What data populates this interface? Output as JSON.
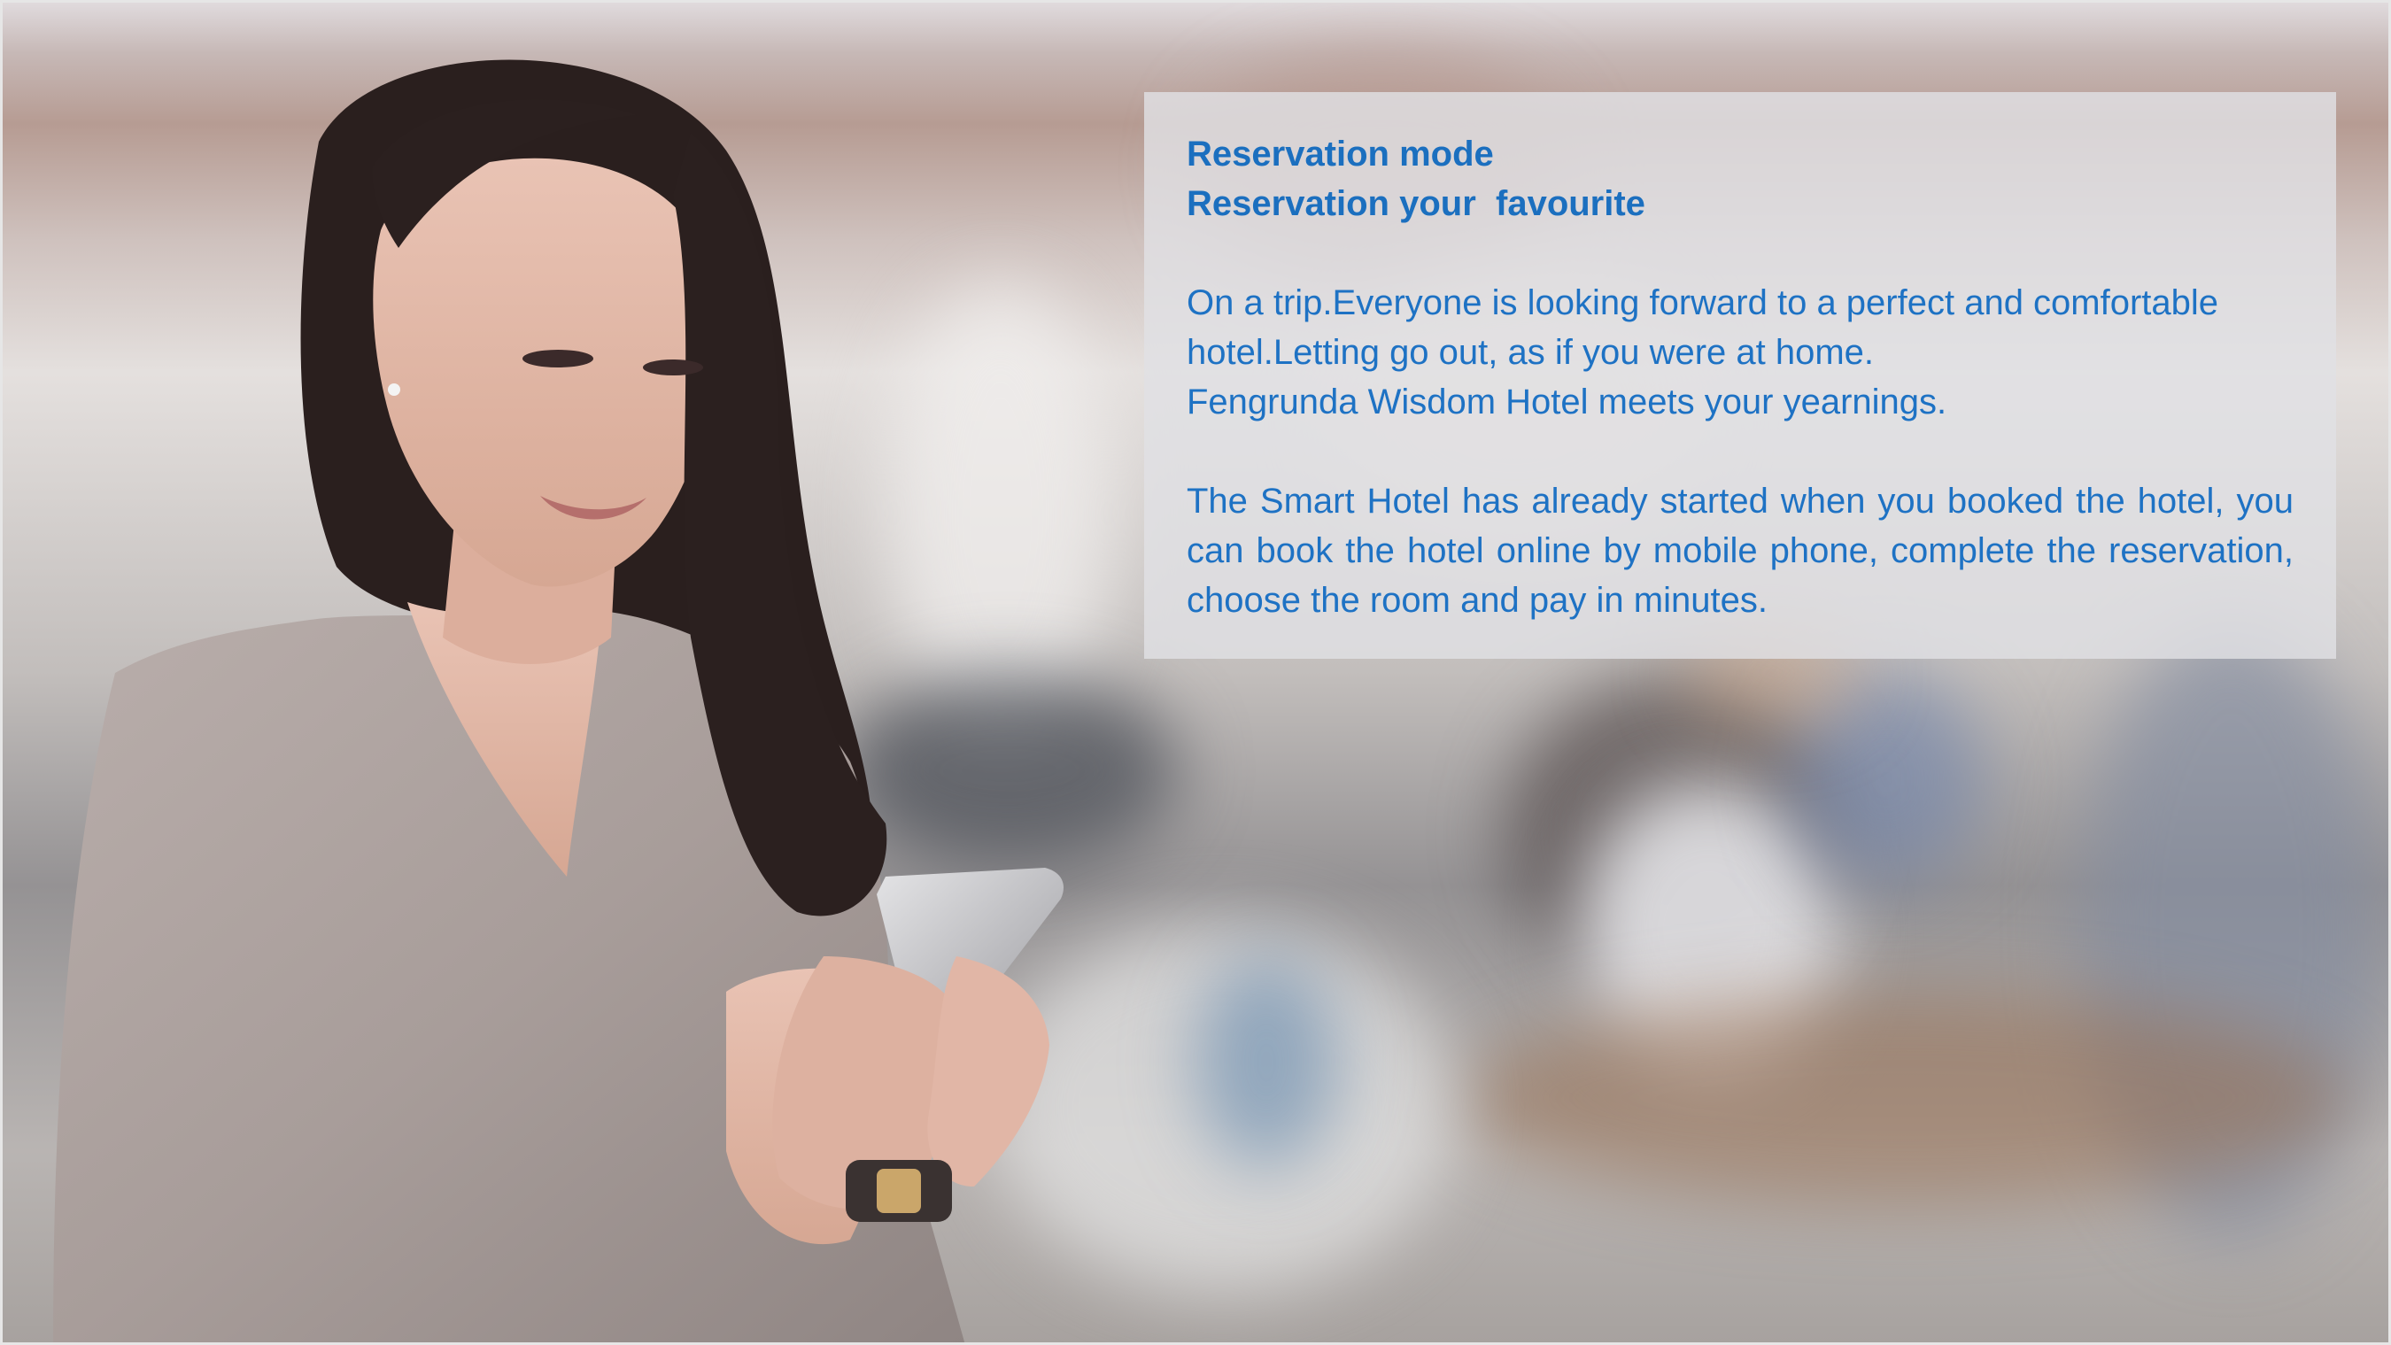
{
  "panel": {
    "heading_line1": "Reservation mode",
    "heading_line2": "Reservation your  favourite",
    "paragraph1_line1": "On a trip.Everyone is looking forward to a perfect and comfortable",
    "paragraph1_line2": "hotel.Letting go out, as if you were at home.",
    "paragraph1_line3": "Fengrunda Wisdom Hotel meets your yearnings.",
    "paragraph2": "The Smart Hotel has already started when you booked the hotel, you can book the hotel online by mobile phone, complete the reservation, choose the room and pay in minutes."
  },
  "colors": {
    "text_blue": "#1e72c4",
    "panel_bg": "rgba(225,225,228,0.82)"
  }
}
